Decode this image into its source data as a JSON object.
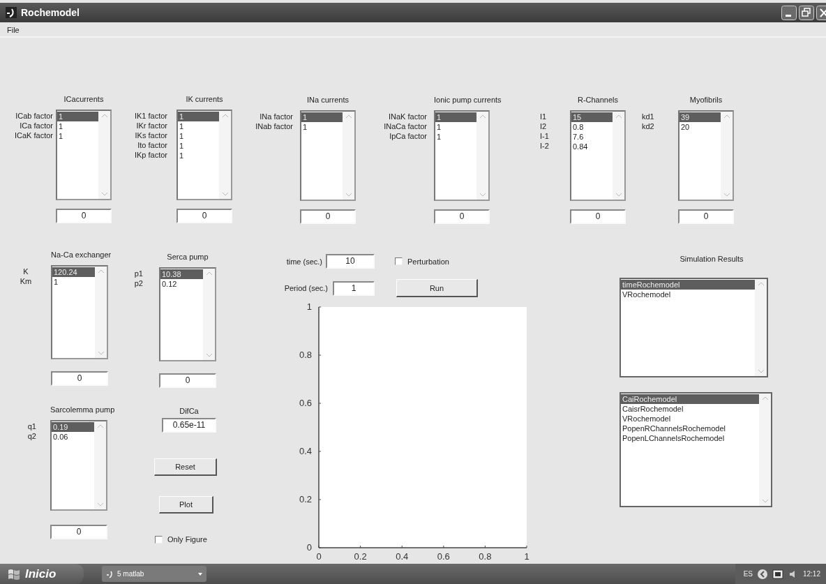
{
  "window": {
    "title": "Rochemodel"
  },
  "menu": [
    "File"
  ],
  "top_groups": [
    {
      "heading": "ICacurrents",
      "labels": [
        "ICab factor",
        "ICa factor",
        "ICaK factor"
      ],
      "values": [
        {
          "text": "1",
          "selected": true
        },
        {
          "text": "1",
          "selected": false
        },
        {
          "text": "1",
          "selected": false
        }
      ],
      "field": "0"
    },
    {
      "heading": "IK currents",
      "labels": [
        "IK1 factor",
        "IKr factor",
        "IKs factor",
        "Ito factor",
        "IKp factor"
      ],
      "values": [
        {
          "text": "1",
          "selected": true
        },
        {
          "text": "1",
          "selected": false
        },
        {
          "text": "1",
          "selected": false
        },
        {
          "text": "1",
          "selected": false
        },
        {
          "text": "1",
          "selected": false
        }
      ],
      "field": "0"
    },
    {
      "heading": "INa currents",
      "labels": [
        "INa factor",
        "INab factor"
      ],
      "values": [
        {
          "text": "1",
          "selected": true
        },
        {
          "text": "1",
          "selected": false
        }
      ],
      "field": "0"
    },
    {
      "heading": "Ionic pump currents",
      "labels": [
        "INaK factor",
        "INaCa factor",
        "IpCa factor"
      ],
      "values": [
        {
          "text": "1",
          "selected": true
        },
        {
          "text": "1",
          "selected": false
        },
        {
          "text": "1",
          "selected": false
        }
      ],
      "field": "0"
    },
    {
      "heading": "R-Channels",
      "labels": [
        "I1",
        "I2",
        "I-1",
        "I-2"
      ],
      "values": [
        {
          "text": "15",
          "selected": true
        },
        {
          "text": "0.8",
          "selected": false
        },
        {
          "text": "7.6",
          "selected": false
        },
        {
          "text": "0.84",
          "selected": false
        }
      ],
      "field": "0"
    },
    {
      "heading": "Myofibrils",
      "labels": [
        "kd1",
        "kd2"
      ],
      "values": [
        {
          "text": "39",
          "selected": true
        },
        {
          "text": "20",
          "selected": false
        }
      ],
      "field": "0"
    }
  ],
  "lower_groups": [
    {
      "heading": "Na-Ca exchanger",
      "labels": [
        "K",
        "Km"
      ],
      "values": [
        {
          "text": "120.24",
          "selected": true
        },
        {
          "text": "1",
          "selected": false
        }
      ],
      "field": "0"
    },
    {
      "heading": "Serca pump",
      "labels": [
        "p1",
        "p2"
      ],
      "values": [
        {
          "text": "10.38",
          "selected": true
        },
        {
          "text": "0.12",
          "selected": false
        }
      ],
      "field": "0"
    },
    {
      "heading": "Sarcolemma pump",
      "labels": [
        "q1",
        "q2"
      ],
      "values": [
        {
          "text": "0.19",
          "selected": true
        },
        {
          "text": "0.06",
          "selected": false
        }
      ],
      "field": "0"
    }
  ],
  "difca": {
    "label": "DifCa",
    "value": "0.65e-11"
  },
  "reset_button": "Reset",
  "plot_button": "Plot",
  "only_figure": {
    "label": "Only Figure",
    "checked": false
  },
  "time": {
    "label": "time (sec.)",
    "value": "10"
  },
  "perturbation": {
    "label": "Perturbation",
    "checked": false
  },
  "period": {
    "label": "Period (sec.)",
    "value": "1"
  },
  "run_button": "Run",
  "plot": {
    "chart_data": {
      "type": "line",
      "xlim": [
        0,
        1
      ],
      "ylim": [
        0,
        1
      ],
      "xticks": [
        0,
        0.2,
        0.4,
        0.6,
        0.8,
        1
      ],
      "yticks": [
        0,
        0.2,
        0.4,
        0.6,
        0.8,
        1
      ]
    }
  },
  "simulation_results": {
    "heading": "Simulation Results",
    "lists": [
      [
        {
          "text": "timeRochemodel",
          "selected": true
        },
        {
          "text": "VRochemodel",
          "selected": false
        }
      ],
      [
        {
          "text": "CaiRochemodel",
          "selected": true
        },
        {
          "text": "CaisrRochemodel",
          "selected": false
        },
        {
          "text": "VRochemodel",
          "selected": false
        },
        {
          "text": "PopenRChannelsRochemodel",
          "selected": false
        },
        {
          "text": "PopenLChannelsRochemodel",
          "selected": false
        }
      ]
    ]
  },
  "taskbar": {
    "start": "Inicio",
    "task": "5 matlab",
    "language": "ES",
    "clock": "12:12"
  }
}
